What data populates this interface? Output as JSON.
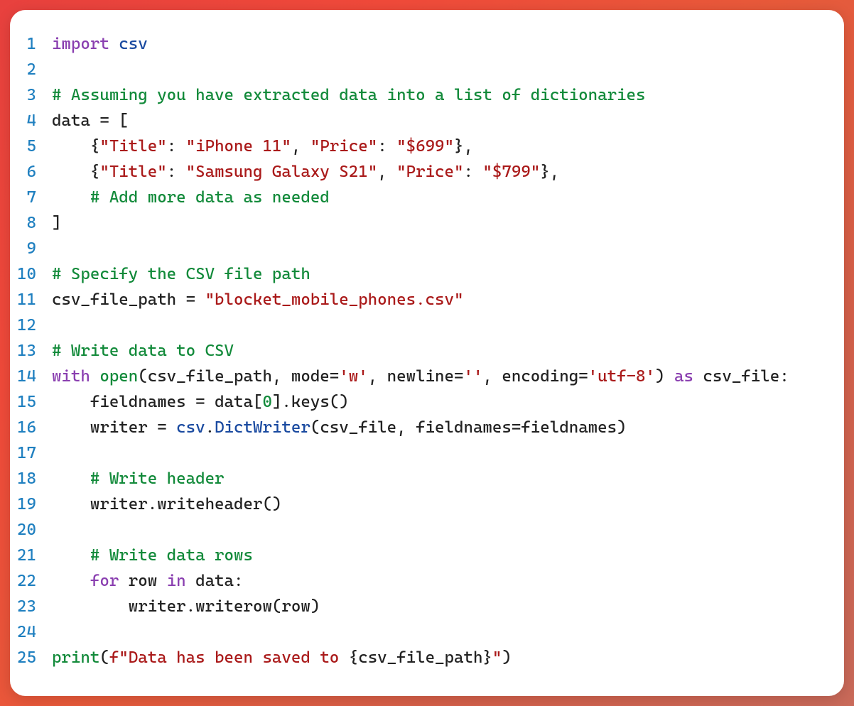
{
  "lines": [
    {
      "n": "1",
      "tokens": [
        {
          "c": "kw-ctrl",
          "t": "import"
        },
        {
          "c": "punct",
          "t": " "
        },
        {
          "c": "mod",
          "t": "csv"
        }
      ]
    },
    {
      "n": "2",
      "tokens": []
    },
    {
      "n": "3",
      "tokens": [
        {
          "c": "comment",
          "t": "# Assuming you have extracted data into a list of dictionaries"
        }
      ]
    },
    {
      "n": "4",
      "tokens": [
        {
          "c": "ident",
          "t": "data "
        },
        {
          "c": "punct",
          "t": "= ["
        }
      ]
    },
    {
      "n": "5",
      "tokens": [
        {
          "c": "punct",
          "t": "    {"
        },
        {
          "c": "str",
          "t": "\"Title\""
        },
        {
          "c": "punct",
          "t": ": "
        },
        {
          "c": "str",
          "t": "\"iPhone 11\""
        },
        {
          "c": "punct",
          "t": ", "
        },
        {
          "c": "str",
          "t": "\"Price\""
        },
        {
          "c": "punct",
          "t": ": "
        },
        {
          "c": "str",
          "t": "\"$699\""
        },
        {
          "c": "punct",
          "t": "},"
        }
      ]
    },
    {
      "n": "6",
      "tokens": [
        {
          "c": "punct",
          "t": "    {"
        },
        {
          "c": "str",
          "t": "\"Title\""
        },
        {
          "c": "punct",
          "t": ": "
        },
        {
          "c": "str",
          "t": "\"Samsung Galaxy S21\""
        },
        {
          "c": "punct",
          "t": ", "
        },
        {
          "c": "str",
          "t": "\"Price\""
        },
        {
          "c": "punct",
          "t": ": "
        },
        {
          "c": "str",
          "t": "\"$799\""
        },
        {
          "c": "punct",
          "t": "},"
        }
      ]
    },
    {
      "n": "7",
      "tokens": [
        {
          "c": "punct",
          "t": "    "
        },
        {
          "c": "comment",
          "t": "# Add more data as needed"
        }
      ]
    },
    {
      "n": "8",
      "tokens": [
        {
          "c": "punct",
          "t": "]"
        }
      ]
    },
    {
      "n": "9",
      "tokens": []
    },
    {
      "n": "10",
      "tokens": [
        {
          "c": "comment",
          "t": "# Specify the CSV file path"
        }
      ]
    },
    {
      "n": "11",
      "tokens": [
        {
          "c": "ident",
          "t": "csv_file_path "
        },
        {
          "c": "punct",
          "t": "= "
        },
        {
          "c": "str",
          "t": "\"blocket_mobile_phones.csv\""
        }
      ]
    },
    {
      "n": "12",
      "tokens": []
    },
    {
      "n": "13",
      "tokens": [
        {
          "c": "comment",
          "t": "# Write data to CSV"
        }
      ]
    },
    {
      "n": "14",
      "tokens": [
        {
          "c": "kw-ctrl",
          "t": "with"
        },
        {
          "c": "punct",
          "t": " "
        },
        {
          "c": "builtin",
          "t": "open"
        },
        {
          "c": "punct",
          "t": "(csv_file_path, mode="
        },
        {
          "c": "str",
          "t": "'w'"
        },
        {
          "c": "punct",
          "t": ", newline="
        },
        {
          "c": "str",
          "t": "''"
        },
        {
          "c": "punct",
          "t": ", encoding="
        },
        {
          "c": "str",
          "t": "'utf-8'"
        },
        {
          "c": "punct",
          "t": ") "
        },
        {
          "c": "kw-ctrl",
          "t": "as"
        },
        {
          "c": "punct",
          "t": " csv_file:"
        }
      ]
    },
    {
      "n": "15",
      "tokens": [
        {
          "c": "punct",
          "t": "    fieldnames "
        },
        {
          "c": "punct",
          "t": "= data["
        },
        {
          "c": "num",
          "t": "0"
        },
        {
          "c": "punct",
          "t": "].keys()"
        }
      ]
    },
    {
      "n": "16",
      "tokens": [
        {
          "c": "punct",
          "t": "    writer "
        },
        {
          "c": "punct",
          "t": "= "
        },
        {
          "c": "mod",
          "t": "csv"
        },
        {
          "c": "punct",
          "t": "."
        },
        {
          "c": "func",
          "t": "DictWriter"
        },
        {
          "c": "punct",
          "t": "(csv_file, fieldnames=fieldnames)"
        }
      ]
    },
    {
      "n": "17",
      "tokens": []
    },
    {
      "n": "18",
      "tokens": [
        {
          "c": "punct",
          "t": "    "
        },
        {
          "c": "comment",
          "t": "# Write header"
        }
      ]
    },
    {
      "n": "19",
      "tokens": [
        {
          "c": "punct",
          "t": "    writer.writeheader()"
        }
      ]
    },
    {
      "n": "20",
      "tokens": []
    },
    {
      "n": "21",
      "tokens": [
        {
          "c": "punct",
          "t": "    "
        },
        {
          "c": "comment",
          "t": "# Write data rows"
        }
      ]
    },
    {
      "n": "22",
      "tokens": [
        {
          "c": "punct",
          "t": "    "
        },
        {
          "c": "kw-ctrl",
          "t": "for"
        },
        {
          "c": "punct",
          "t": " row "
        },
        {
          "c": "kw-ctrl",
          "t": "in"
        },
        {
          "c": "punct",
          "t": " data:"
        }
      ]
    },
    {
      "n": "23",
      "tokens": [
        {
          "c": "punct",
          "t": "        writer.writerow(row)"
        }
      ]
    },
    {
      "n": "24",
      "tokens": []
    },
    {
      "n": "25",
      "tokens": [
        {
          "c": "builtin",
          "t": "print"
        },
        {
          "c": "punct",
          "t": "("
        },
        {
          "c": "str",
          "t": "f\"Data has been saved to "
        },
        {
          "c": "punct",
          "t": "{csv_file_path}"
        },
        {
          "c": "str",
          "t": "\""
        },
        {
          "c": "punct",
          "t": ")"
        }
      ]
    }
  ]
}
